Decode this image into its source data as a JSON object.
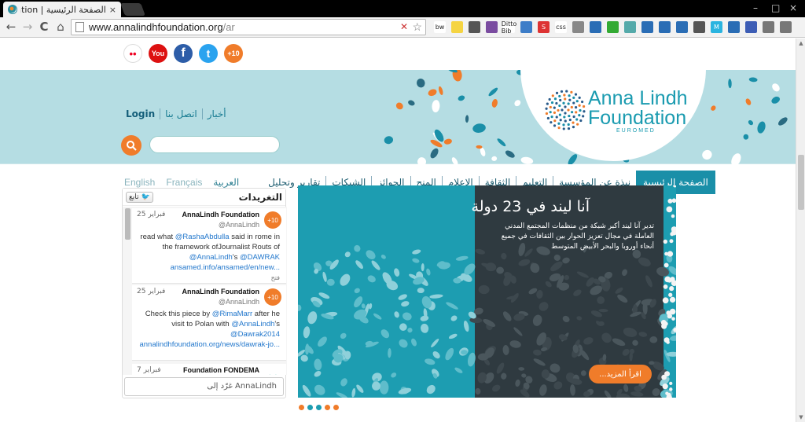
{
  "browser": {
    "tab_title": "الصفحة الرئيسية | dation",
    "tab_close": "×",
    "url_host": "www.annalindhfoundation.org",
    "url_path": "/ar",
    "back": "←",
    "forward": "→",
    "reload": "C",
    "home": "⌂",
    "minimize": "–",
    "maximize": "□",
    "close": "×",
    "extensions": [
      "bw",
      "",
      "",
      "",
      "Ditto Bib",
      "",
      "S",
      "css",
      "",
      "",
      "",
      "",
      "",
      "",
      "",
      "",
      "M",
      "",
      "",
      "",
      ""
    ]
  },
  "social": {
    "flickr": "••",
    "youtube": "You",
    "facebook": "f",
    "twitter": "t",
    "plus10": "+10"
  },
  "logo": {
    "line1": "Anna Lindh",
    "line2": "Foundation",
    "tagline": "EUROMED"
  },
  "toplinks": [
    "Login",
    "اتصل بنا",
    "أخبار"
  ],
  "nav": {
    "languages": [
      "English",
      "Français",
      "العربية"
    ],
    "items": [
      "تقارير وتحليل",
      "الشبكات",
      "الجوائز",
      "المنح",
      "الإعلام",
      "الثقافة",
      "التعليم",
      "نبذة عن المؤسسة",
      "الصفحة الرئيسية"
    ]
  },
  "tweets": {
    "title": "التغريدات",
    "follow": "تابع",
    "compose_placeholder": "غرّد إلى AnnaLindh",
    "items": [
      {
        "date": "25 فبراير",
        "name": "AnnaLindh Foundation",
        "handle": "@AnnaLindh",
        "avatar": "+10",
        "text_before": "read what ",
        "mention": "@RashaAbdulla",
        "text_after": " said in rome in the framework ofJournalist Routs of",
        "mention2": "@AnnaLindh",
        "mid": "'s ",
        "mention3": "@DAWRAK",
        "link": "ansamed.info/ansamed/en/new...",
        "open": "فتح"
      },
      {
        "date": "25 فبراير",
        "name": "AnnaLindh Foundation",
        "handle": "@AnnaLindh",
        "avatar": "+10",
        "text_before": "Check this piece by ",
        "mention": "@RimaMarr",
        "text_after": " after he visit to Polan with ",
        "mention2": "@AnnaLindh",
        "mid": "'s",
        "mention3": "@Dawrak2014",
        "link": "annalindhfoundation.org/news/dawrak-jo...",
        "open": ""
      },
      {
        "date": "7 فبراير",
        "name": "Foundation FONDEMA",
        "handle": "",
        "avatar": "",
        "text_before": "",
        "mention": "",
        "text_after": "",
        "mention2": "",
        "mid": "",
        "mention3": "",
        "link": "",
        "open": ""
      }
    ]
  },
  "slider": {
    "title": "آنا ليند في 23 دولة",
    "text": "تدير آنا ليند أكبر شبكة من منظمات المجتمع المدني العاملة في مجال تعزيز الحوار بين الثقافات في جميع أنحاء أوروبا والبحر الأبيض المتوسط",
    "button": "اقرأ المزيد...",
    "dot_colors": [
      "#f07c2a",
      "#1d9db1",
      "#1d9db1",
      "#f07c2a",
      "#f07c2a"
    ]
  },
  "colors": {
    "accent_orange": "#f07c2a",
    "teal": "#1a8fa8",
    "header_bg": "#b5dde3"
  }
}
